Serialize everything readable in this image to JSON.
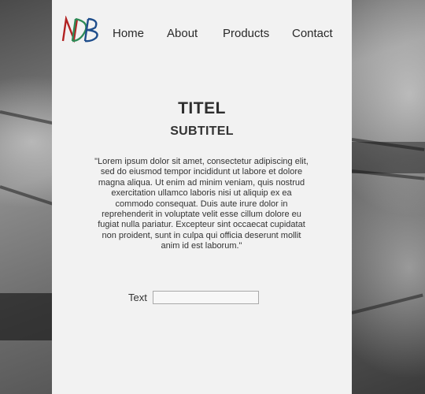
{
  "header": {
    "logo_text": "NDB",
    "nav": [
      {
        "label": "Home"
      },
      {
        "label": "About"
      },
      {
        "label": "Products"
      },
      {
        "label": "Contact"
      }
    ]
  },
  "main": {
    "title": "TITEL",
    "subtitle": "SUBTITEL",
    "body": "\"Lorem ipsum dolor sit amet, consectetur adipiscing elit, sed do eiusmod tempor incididunt ut labore et dolore magna aliqua. Ut enim ad minim veniam, quis nostrud exercitation ullamco laboris nisi ut aliquip ex ea commodo consequat. Duis aute irure dolor in reprehenderit in voluptate velit esse cillum dolore eu fugiat nulla pariatur. Excepteur sint occaecat cupidatat non proident, sunt in culpa qui officia deserunt mollit anim id est laborum.\""
  },
  "form": {
    "label": "Text",
    "value": "",
    "placeholder": ""
  },
  "colors": {
    "panel": "#f2f2f2",
    "text": "#2e2e2e",
    "logo_n": "#b22222",
    "logo_d": "#2e8b57",
    "logo_b": "#1f4e8c"
  }
}
